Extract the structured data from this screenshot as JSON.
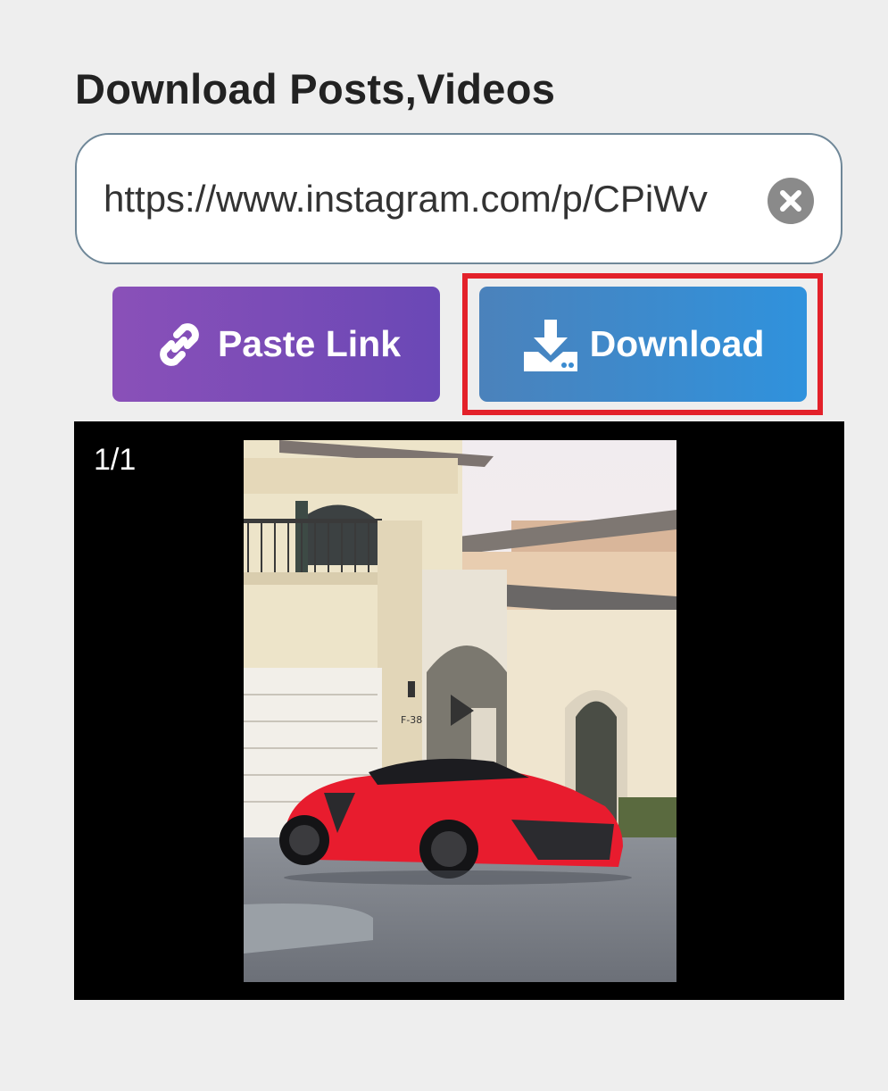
{
  "header": {
    "title": "Download Posts,Videos"
  },
  "url_field": {
    "value": "https://www.instagram.com/p/CPiWv",
    "clear_icon": "close-circle-icon"
  },
  "buttons": {
    "paste": {
      "label": "Paste Link",
      "icon": "link-icon"
    },
    "download": {
      "label": "Download",
      "icon": "download-tray-icon"
    }
  },
  "media": {
    "counter": "1/1",
    "image_description_icon": "photo"
  },
  "colors": {
    "highlight": "#e3212a",
    "paste_button": "#7a4cb7",
    "download_button": "#3a8bd0"
  }
}
